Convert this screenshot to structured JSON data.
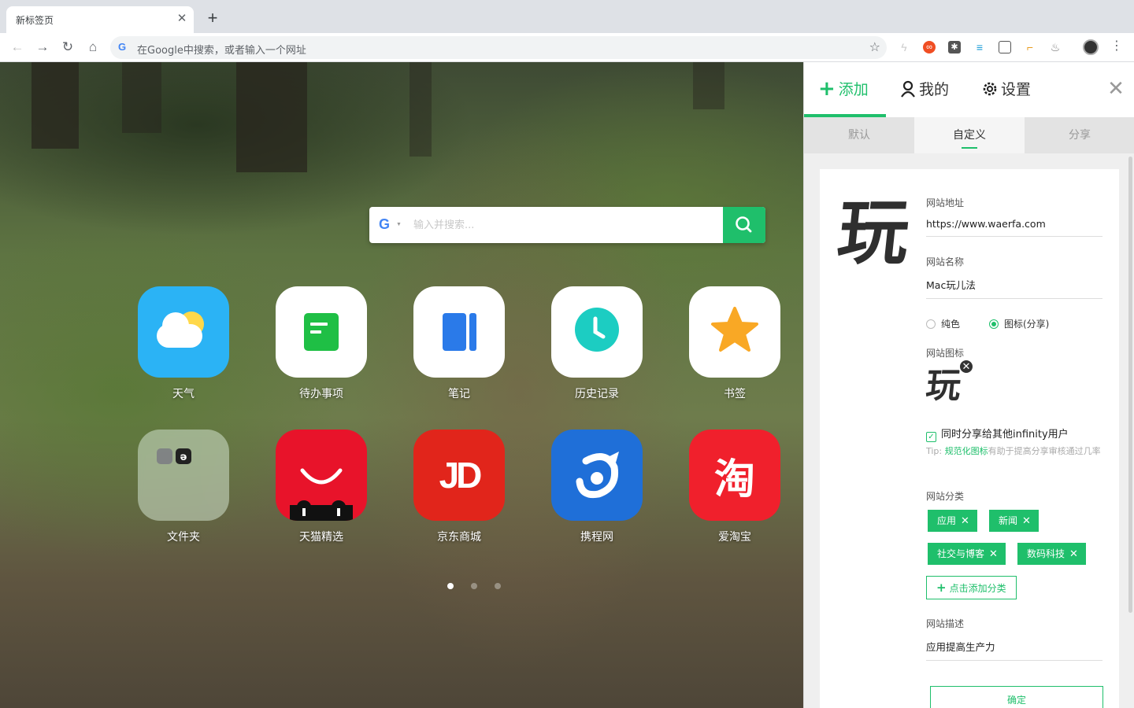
{
  "browser": {
    "tab_title": "新标签页",
    "tab_close": "✕",
    "new_tab": "+",
    "omnibox_placeholder": "在Google中搜索，或者输入一个网址",
    "omnibox_g": "G"
  },
  "search": {
    "engine": "G",
    "placeholder": "输入并搜索..."
  },
  "apps": [
    {
      "label": "天气"
    },
    {
      "label": "待办事项"
    },
    {
      "label": "笔记"
    },
    {
      "label": "历史记录"
    },
    {
      "label": "书签"
    },
    {
      "label": "文件夹"
    },
    {
      "label": "天猫精选"
    },
    {
      "label": "京东商城",
      "icon_text": "JD"
    },
    {
      "label": "携程网"
    },
    {
      "label": "爱淘宝",
      "icon_text": "淘"
    }
  ],
  "pagination": {
    "current": 1,
    "total": 3
  },
  "panel": {
    "tabs": [
      {
        "icon": "+",
        "label": "添加"
      },
      {
        "icon": "person-icon",
        "label": "我的"
      },
      {
        "icon": "gear-icon",
        "label": "设置"
      }
    ],
    "close": "✕",
    "subtabs": [
      "默认",
      "自定义",
      "分享"
    ],
    "form": {
      "logo_char": "玩",
      "url_label": "网站地址",
      "url_value": "https://www.waerfa.com",
      "name_label": "网站名称",
      "name_value": "Mac玩儿法",
      "radio_solid": "纯色",
      "radio_icon": "图标(分享)",
      "icon_label": "网站图标",
      "share_label": "同时分享给其他infinity用户",
      "tip_prefix": "Tip: ",
      "tip_link": "规范化图标",
      "tip_rest": "有助于提高分享审核通过几率",
      "category_label": "网站分类",
      "categories": [
        "应用",
        "新闻",
        "社交与博客",
        "数码科技"
      ],
      "add_category": "点击添加分类",
      "desc_label": "网站描述",
      "desc_value": "应用提高生产力",
      "confirm": "确定"
    }
  },
  "colors": {
    "accent": "#1fbf6b",
    "tmall_red": "#e8132a",
    "jd_red": "#e1251b",
    "ctrip_blue": "#1f6fd8",
    "taobao_red": "#f0202c",
    "weather_blue": "#2bb3f5"
  }
}
